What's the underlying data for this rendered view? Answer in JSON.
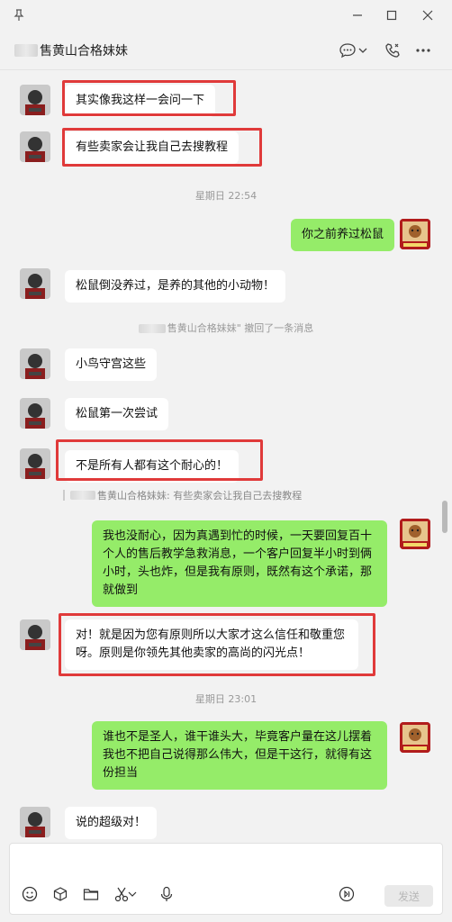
{
  "window": {
    "pin_icon": "pin-icon",
    "min_icon": "minimize-icon",
    "max_icon": "maximize-icon",
    "close_icon": "close-icon"
  },
  "header": {
    "contact_name": "售黄山合格妹妹",
    "icons": [
      "chat-bubble-icon",
      "chevron-down-icon",
      "phone-icon",
      "more-icon"
    ]
  },
  "messages": [
    {
      "side": "left",
      "text": "其实像我这样一会问一下",
      "highlight": true
    },
    {
      "side": "left",
      "text": "有些卖家会让我自己去搜教程",
      "highlight": true
    },
    {
      "type": "time",
      "text": "星期日 22:54"
    },
    {
      "side": "right",
      "text": "你之前养过松鼠"
    },
    {
      "side": "left",
      "text": "松鼠倒没养过，是养的其他的小动物！"
    },
    {
      "type": "recall",
      "name": "售黄山合格妹妹",
      "text": "\" 撤回了一条消息"
    },
    {
      "side": "left",
      "text": "小鸟守宫这些"
    },
    {
      "side": "left",
      "text": "松鼠第一次尝试"
    },
    {
      "side": "left",
      "text": "不是所有人都有这个耐心的！",
      "highlight": true
    },
    {
      "type": "quote",
      "text": "售黄山合格妹妹: 有些卖家会让我自己去搜教程"
    },
    {
      "side": "right",
      "text": "我也没耐心，因为真遇到忙的时候，一天要回复百十个人的售后教学急救消息，一个客户回复半小时到俩小时，头也炸，但是我有原则，既然有这个承诺，那就做到"
    },
    {
      "side": "left",
      "text": "对！就是因为您有原则所以大家才这么信任和敬重您呀。原则是你领先其他卖家的高尚的闪光点！",
      "highlight": true
    },
    {
      "type": "time",
      "text": "星期日 23:01"
    },
    {
      "side": "right",
      "text": "谁也不是圣人，谁干谁头大，毕竟客户量在这儿摆着   我也不把自己说得那么伟大，但是干这行，就得有这份担当"
    },
    {
      "side": "left",
      "text": "说的超级对！"
    }
  ],
  "input": {
    "tools": [
      "emoji-icon",
      "box-icon",
      "folder-icon",
      "scissors-icon",
      "chevron-down-icon",
      "mic-icon",
      "voice-icon"
    ],
    "send_label": "发送"
  }
}
